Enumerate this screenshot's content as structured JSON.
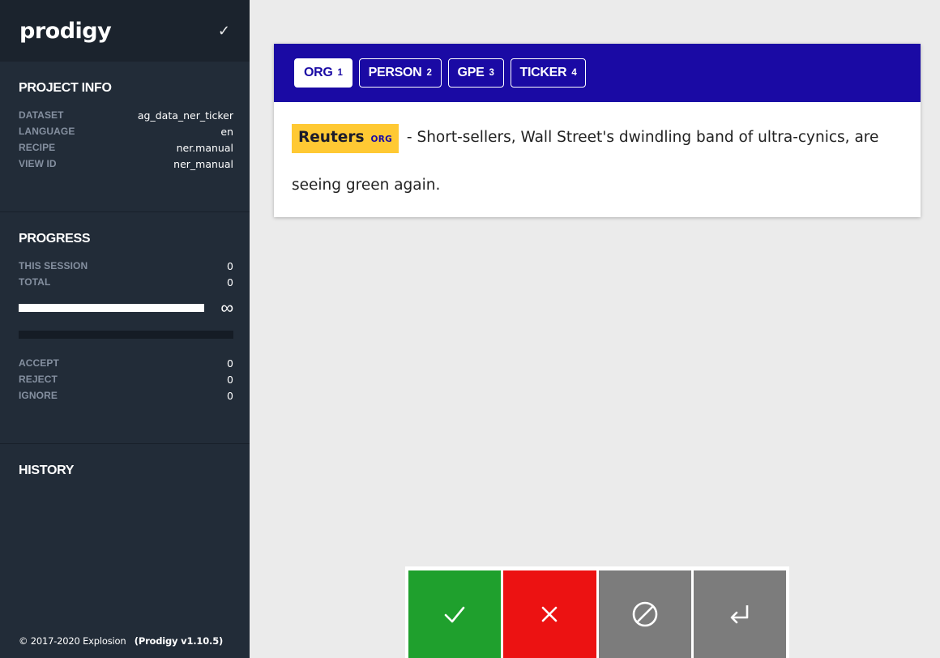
{
  "app": {
    "logo": "prodigy",
    "header_check": "✓"
  },
  "project_info": {
    "title": "PROJECT INFO",
    "rows": [
      {
        "key": "DATASET",
        "value": "ag_data_ner_ticker"
      },
      {
        "key": "LANGUAGE",
        "value": "en"
      },
      {
        "key": "RECIPE",
        "value": "ner.manual"
      },
      {
        "key": "VIEW ID",
        "value": "ner_manual"
      }
    ]
  },
  "progress": {
    "title": "PROGRESS",
    "this_session_label": "THIS SESSION",
    "this_session_value": "0",
    "total_label": "TOTAL",
    "total_value": "0",
    "bar_fraction": 1.0,
    "infinity": "∞",
    "accept_label": "ACCEPT",
    "accept_value": "0",
    "reject_label": "REJECT",
    "reject_value": "0",
    "ignore_label": "IGNORE",
    "ignore_value": "0"
  },
  "history": {
    "title": "HISTORY"
  },
  "footer": {
    "copyright": "© 2017-2020 Explosion",
    "version": "(Prodigy v1.10.5)"
  },
  "labels": [
    {
      "name": "ORG",
      "key": "1",
      "selected": true
    },
    {
      "name": "PERSON",
      "key": "2",
      "selected": false
    },
    {
      "name": "GPE",
      "key": "3",
      "selected": false
    },
    {
      "name": "TICKER",
      "key": "4",
      "selected": false
    }
  ],
  "task": {
    "entity_text": "Reuters",
    "entity_label": "ORG",
    "text_after": " - Short-sellers, Wall Street's dwindling band of ultra-cynics, are seeing green again."
  },
  "colors": {
    "label_bar": "#1a0aa4",
    "entity_highlight": "#ffc933",
    "accept": "#1fa02d",
    "reject": "#ec1212",
    "ignore": "#7c7c7c",
    "sidebar": "#222c38"
  },
  "actions": [
    {
      "name": "accept",
      "icon": "check-icon"
    },
    {
      "name": "reject",
      "icon": "close-icon"
    },
    {
      "name": "ignore",
      "icon": "ban-icon"
    },
    {
      "name": "undo",
      "icon": "return-icon"
    }
  ]
}
